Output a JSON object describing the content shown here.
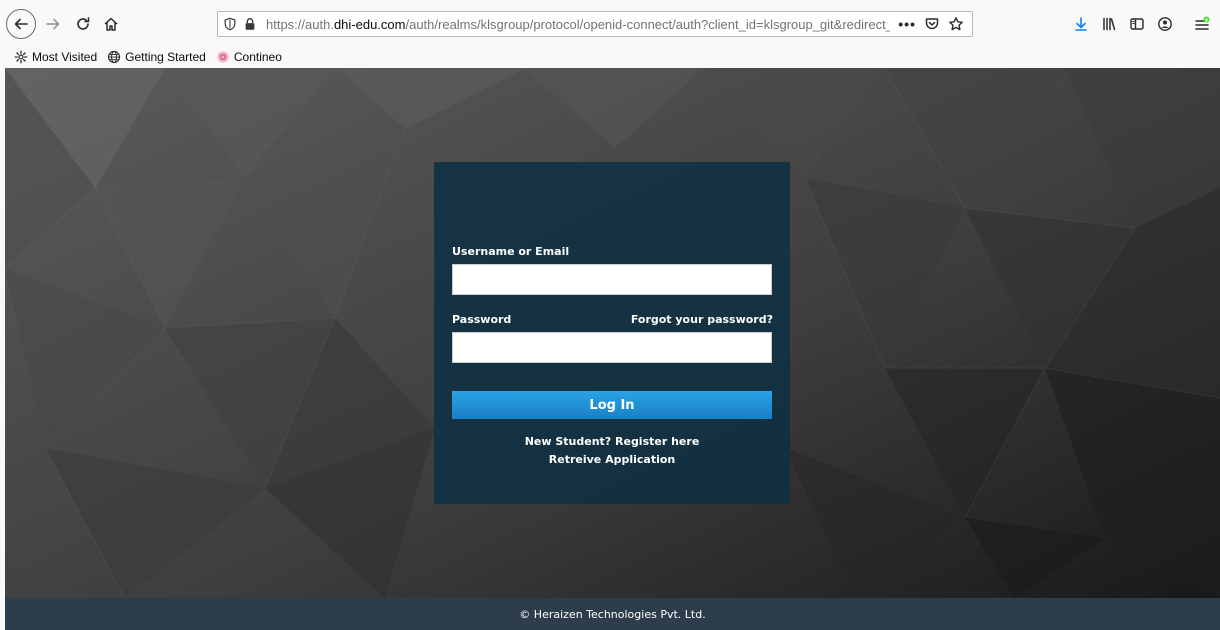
{
  "browser": {
    "url_host_prefix": "https://auth.",
    "url_host": "dhi-edu.com",
    "url_path": "/auth/realms/klsgroup/protocol/openid-connect/auth?client_id=klsgroup_git&redirect_uri",
    "more_label": "•••"
  },
  "bookmarks": {
    "items": [
      {
        "label": "Most Visited",
        "icon": "gear-icon"
      },
      {
        "label": "Getting Started",
        "icon": "globe-icon"
      },
      {
        "label": "Contineo",
        "icon": "favicon-icon"
      }
    ]
  },
  "login": {
    "username_label": "Username or Email",
    "username_value": "",
    "password_label": "Password",
    "password_value": "",
    "forgot_label": "Forgot your password?",
    "login_button": "Log In",
    "register_link": "New Student? Register here",
    "retrieve_link": "Retreive Application"
  },
  "footer": {
    "copyright": "© Heraizen Technologies Pvt. Ltd."
  },
  "colors": {
    "card_bg": "#0e3042",
    "button_blue": "#1e8fd6",
    "footer_bg": "#2e3d4b",
    "download_icon": "#0a84ff",
    "addon_badge": "#30e60b"
  }
}
